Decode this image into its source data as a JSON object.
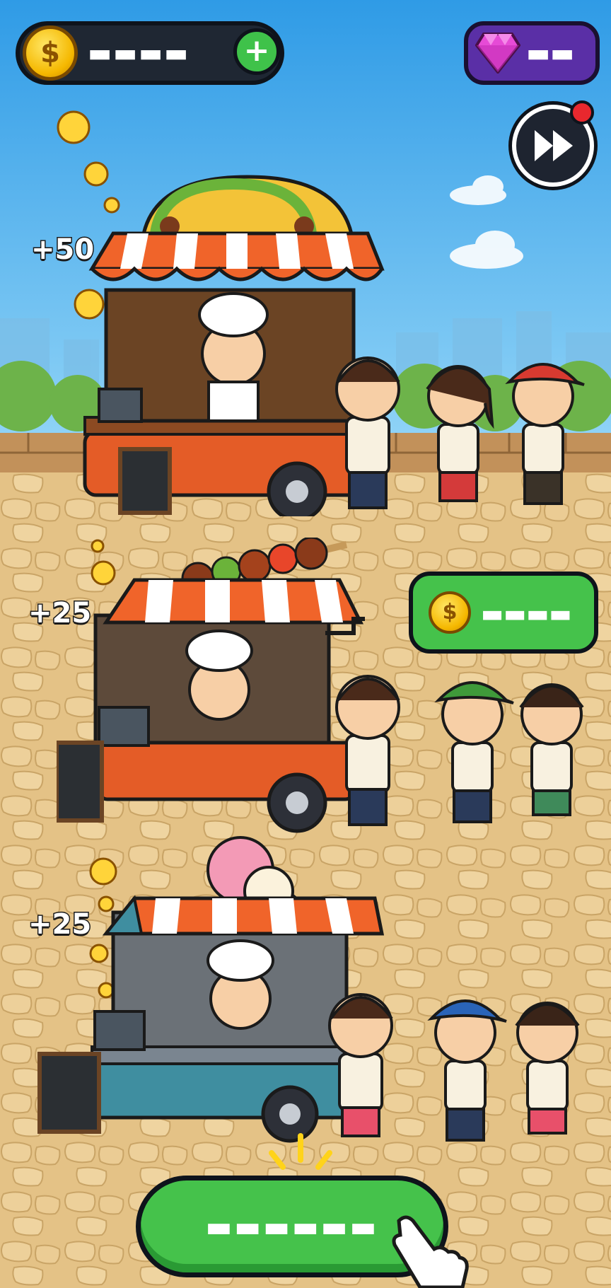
{
  "hud": {
    "coins_value": "▬▬▬▬",
    "plus_label": "+",
    "gems_value": "▬▬"
  },
  "stalls": [
    {
      "name": "taco",
      "reward": "+50",
      "customers": 3
    },
    {
      "name": "kebab",
      "reward": "+25",
      "customers": 3,
      "earnings_value": "▬▬▬▬"
    },
    {
      "name": "ice-cream",
      "reward": "+25",
      "customers": 3
    }
  ],
  "coin_symbol": "$",
  "main_button": {
    "label": "▬▬▬▬▬▬"
  },
  "colors": {
    "sky": "#3aa6ea",
    "ground": "#e6c58c",
    "accent_green": "#45c24b",
    "gem_purple": "#5a2fa6",
    "awning_orange": "#f0642a"
  }
}
